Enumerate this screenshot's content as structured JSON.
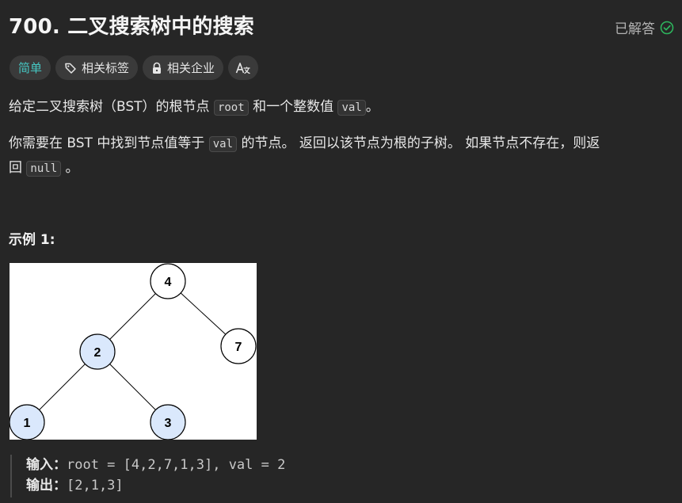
{
  "problem": {
    "title": "700. 二叉搜索树中的搜索",
    "solved_label": "已解答",
    "status_color": "#2db55d"
  },
  "tags": {
    "difficulty": "简单",
    "topics": "相关标签",
    "companies": "相关企业",
    "translate_icon": "translate-icon"
  },
  "description": {
    "p1_before": "给定二叉搜索树（BST）的根节点 ",
    "p1_code1": "root",
    "p1_mid": " 和一个整数值 ",
    "p1_code2": "val",
    "p1_after": "。",
    "p2_before": "你需要在 BST 中找到节点值等于 ",
    "p2_code1": "val",
    "p2_mid": " 的节点。 返回以该节点为根的子树。 如果节点不存在，则返",
    "p2_line2": "回 ",
    "p2_code2": "null",
    "p2_after": " 。"
  },
  "example": {
    "title": "示例 1:",
    "tree": {
      "nodes": [
        {
          "label": "4",
          "highlight": false
        },
        {
          "label": "2",
          "highlight": true
        },
        {
          "label": "7",
          "highlight": false
        },
        {
          "label": "1",
          "highlight": true
        },
        {
          "label": "3",
          "highlight": true
        }
      ],
      "highlight_color": "#dae8fc"
    },
    "input_label": "输入：",
    "input_value": "root = [4,2,7,1,3], val = 2",
    "output_label": "输出：",
    "output_value": "[2,1,3]"
  }
}
